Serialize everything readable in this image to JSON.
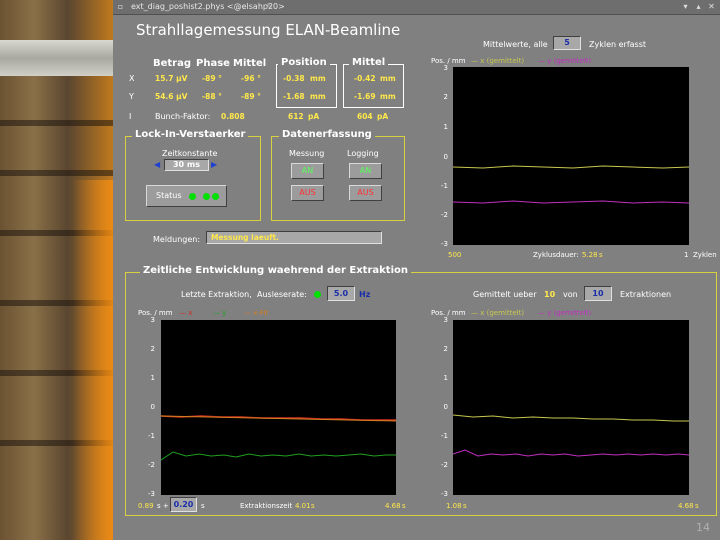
{
  "window": {
    "title": "ext_diag_poshist2.phys <@elsahp20>"
  },
  "title": "Strahllagemessung ELAN-Beamline",
  "table": {
    "headers": [
      "Betrag",
      "Phase",
      "Mittel"
    ],
    "rows": [
      {
        "label": "X",
        "betrag": "15.7 µV",
        "phase": "-89 °",
        "mittel": "-96 °"
      },
      {
        "label": "Y",
        "betrag": "54.6 µV",
        "phase": "-88 °",
        "mittel": "-89 °"
      }
    ],
    "i_label": "I",
    "bunch_label": "Bunch-Faktor:",
    "bunch_value": "0.808"
  },
  "position": {
    "title": "Position",
    "x": "-0.38",
    "y": "-1.68",
    "unit": "mm",
    "current": "612",
    "current_unit": "pA"
  },
  "mittel": {
    "title": "Mittel",
    "x": "-0.42",
    "y": "-1.69",
    "unit": "mm",
    "current": "604",
    "current_unit": "pA"
  },
  "lockin": {
    "title": "Lock-In-Verstaerker",
    "zeit_label": "Zeitkonstante",
    "zeit_value": "30 ms",
    "status_label": "Status"
  },
  "daten": {
    "title": "Datenerfassung",
    "messung_label": "Messung",
    "logging_label": "Logging",
    "an_label": "AN",
    "aus_label": "AUS"
  },
  "meldungen": {
    "label": "Meldungen:",
    "value": "Messung laeuft."
  },
  "top_plot": {
    "mittelwerte_label": "Mittelwerte, alle",
    "mittelwerte_value": "5",
    "zyklen_label": "Zyklen erfasst",
    "ylabel": "Pos. / mm",
    "legend_x": "x (gemittelt)",
    "legend_y": "y (gemittelt)",
    "x_left": "500",
    "x_right": "1",
    "x_right_unit": "Zyklen",
    "zyklus_label": "Zyklusdauer:",
    "zyklus_value": "5.28",
    "zyklus_unit": "s"
  },
  "extraktion": {
    "title": "Zeitliche Entwicklung waehrend der Extraktion",
    "letzte_label": "Letzte Extraktion,",
    "auslese_label": "Ausleserate:",
    "auslese_value": "5.0",
    "auslese_unit": "Hz",
    "gemittelt_label": "Gemittelt ueber",
    "gemittelt_value": "10",
    "von_label": "von",
    "von_value": "10",
    "extraktionen_label": "Extraktionen"
  },
  "left_plot": {
    "ylabel": "Pos. / mm",
    "legend_x": "x",
    "legend_y": "y",
    "legend_fit": "x-Fit",
    "x_left": "0.89",
    "x_left_unit": "s +",
    "offset_value": "0.20",
    "offset_unit": "s",
    "extraktionszeit_label": "Extraktionszeit",
    "extraktionszeit_value": "4.01",
    "extraktionszeit_unit": "s",
    "x_right": "4.68",
    "x_right_unit": "s"
  },
  "right_plot": {
    "ylabel": "Pos. / mm",
    "legend_x": "x (gemittelt)",
    "legend_y": "y (gemittelt)",
    "x_left": "1.08",
    "x_left_unit": "s",
    "x_right": "4.68",
    "x_right_unit": "s"
  },
  "yticks": [
    "3",
    "2",
    "1",
    "0",
    "-1",
    "-2",
    "-3"
  ],
  "page_number": "14",
  "colors": {
    "x_top": "#c8c850",
    "y_top": "#c030c0",
    "x_left": "#d03020",
    "y_left": "#20a020",
    "fit_left": "#d08020",
    "x_right": "#c8c850",
    "y_right": "#c030c0"
  }
}
